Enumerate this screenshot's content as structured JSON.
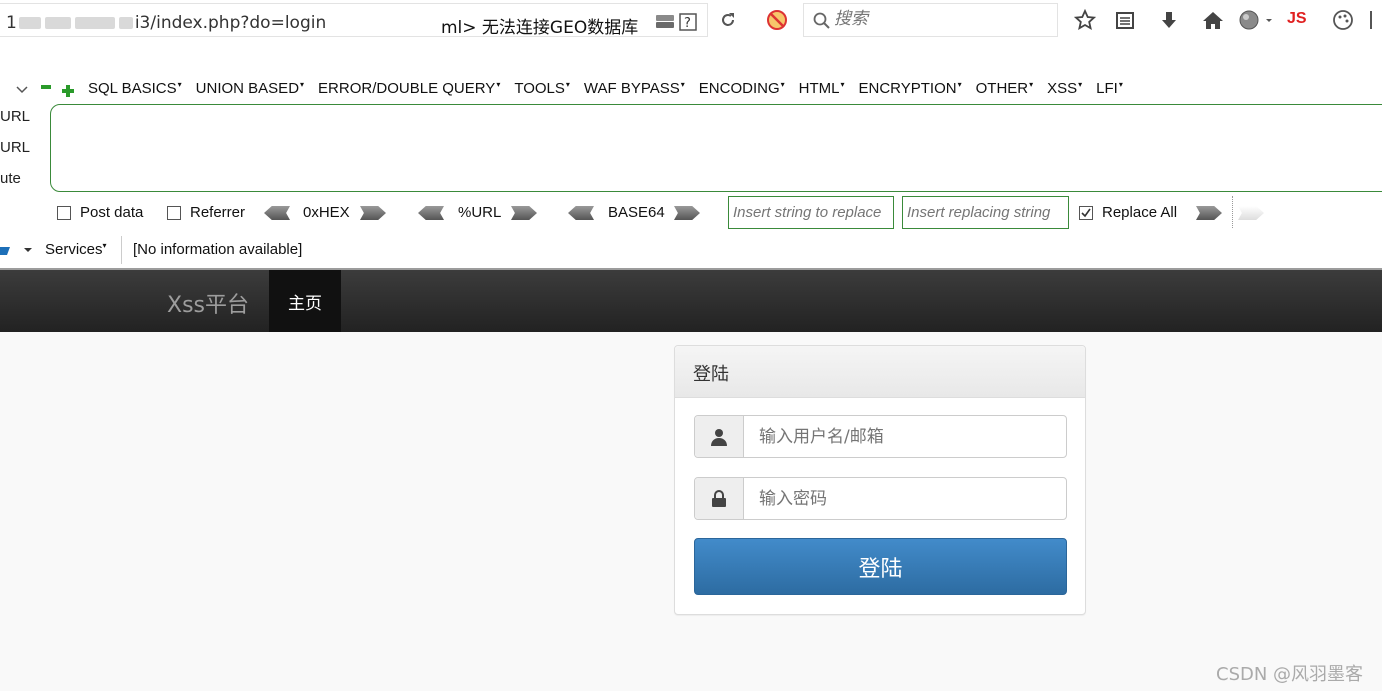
{
  "browser": {
    "url_prefix": "1",
    "url_path": "i3/index.php?do=login",
    "page_title": "ml>  无法连接GEO数据库",
    "search_placeholder": "搜索",
    "js_label": "JS"
  },
  "hackbar": {
    "menus": [
      "SQL BASICS",
      "UNION BASED",
      "ERROR/DOUBLE QUERY",
      "TOOLS",
      "WAF BYPASS",
      "ENCODING",
      "HTML",
      "ENCRYPTION",
      "OTHER",
      "XSS",
      "LFI"
    ],
    "side_labels": [
      "URL",
      "URL",
      "ute"
    ],
    "post_data_label": "Post data",
    "referrer_label": "Referrer",
    "hex_label": "0xHEX",
    "url_label": "%URL",
    "base64_label": "BASE64",
    "insert_placeholder": "Insert string to replace",
    "replacing_placeholder": "Insert replacing string",
    "replace_all_label": "Replace All",
    "replace_all_checked": true,
    "services_label": "Services",
    "info_text": "[No information available]"
  },
  "navbar": {
    "brand": "Xss平台",
    "home": "主页"
  },
  "login": {
    "panel_title": "登陆",
    "username_placeholder": "输入用户名/邮箱",
    "password_placeholder": "输入密码",
    "submit_label": "登陆"
  },
  "watermark": "CSDN @风羽墨客",
  "colors": {
    "primary_button": "#337ab7",
    "navbar_bg": "#222222",
    "hackbar_border": "#3a8a3a",
    "js_red": "#e02020"
  }
}
